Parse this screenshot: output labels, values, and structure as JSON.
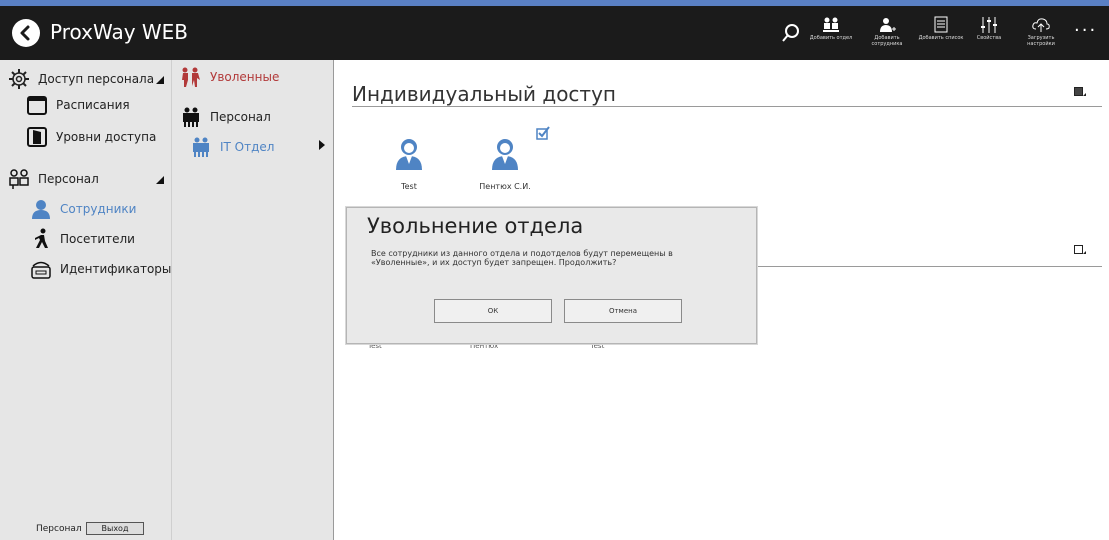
{
  "app": {
    "title": "ProxWay WEB"
  },
  "toolbar": {
    "buttons": [
      {
        "label": "Добавить отдел",
        "icon": "add-department-icon"
      },
      {
        "label": "Добавить сотрудника",
        "icon": "add-employee-icon"
      },
      {
        "label": "Добавить список",
        "icon": "add-list-icon"
      },
      {
        "label": "Свойства",
        "icon": "properties-icon"
      },
      {
        "label": "Загрузить настройки",
        "icon": "upload-settings-icon"
      }
    ],
    "more": "···"
  },
  "sidebar": {
    "groups": [
      {
        "label": "Доступ персонала",
        "items": [
          "Расписания",
          "Уровни доступа"
        ]
      },
      {
        "label": "Персонал",
        "items": [
          "Сотрудники",
          "Посетители",
          "Идентификаторы"
        ],
        "active": "Сотрудники"
      }
    ],
    "footer": {
      "user": "Персонал",
      "logout": "Выход"
    }
  },
  "tree": {
    "fired": "Уволенные",
    "staff": "Персонал",
    "department": "IT Отдел"
  },
  "main": {
    "section_title": "Индивидуальный доступ",
    "persons": [
      {
        "name": "Test",
        "checked": false
      },
      {
        "name": "Пентюх С.И.",
        "checked": true
      }
    ],
    "obscured_row": [
      "Test",
      "Пентюх",
      "Test"
    ]
  },
  "dialog": {
    "title": "Увольнение отдела",
    "message": "Все сотрудники из данного отдела и подотделов будут перемещены в «Уволенные», и их доступ будет запрещен. Продолжить?",
    "ok_label": "ОК",
    "cancel_label": "Отмена"
  },
  "colors": {
    "accent": "#5a80c4",
    "fired_red": "#b23a3a",
    "active_blue": "#4f84c4",
    "topbar": "#1b1b1b"
  }
}
